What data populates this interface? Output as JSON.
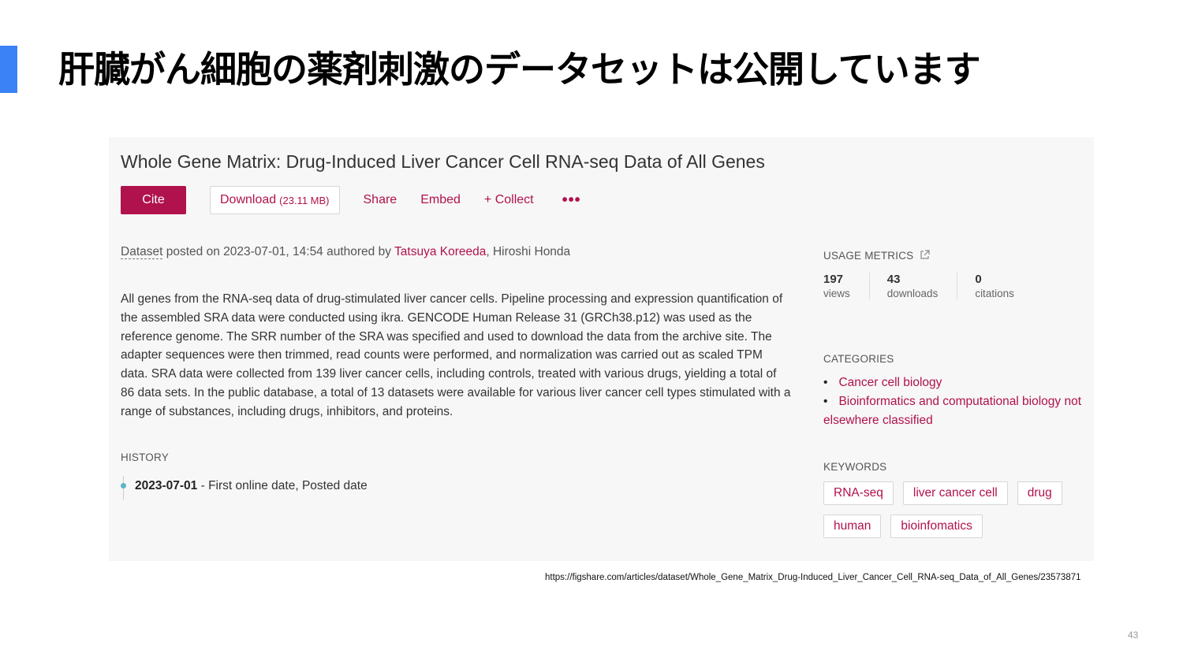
{
  "slide": {
    "title": "肝臓がん細胞の薬剤刺激のデータセットは公開しています",
    "source_url": "https://figshare.com/articles/dataset/Whole_Gene_Matrix_Drug-Induced_Liver_Cancer_Cell_RNA-seq_Data_of_All_Genes/23573871",
    "page_number": "43",
    "accent_color": "#3b82f6"
  },
  "dataset": {
    "title": "Whole Gene Matrix: Drug-Induced Liver Cancer Cell RNA-seq Data of All Genes",
    "toolbar": {
      "cite_label": "Cite",
      "download_label": "Download",
      "download_size": "(23.11 MB)",
      "share_label": "Share",
      "embed_label": "Embed",
      "collect_label": "+ Collect",
      "more_label": "•••"
    },
    "byline": {
      "type": "Dataset",
      "posted_text": " posted on 2023-07-01, 14:54 authored by ",
      "author_1": "Tatsuya Koreeda",
      "author_2": ", Hiroshi Honda"
    },
    "description": "All genes from the RNA-seq data of drug-stimulated liver cancer cells. Pipeline processing and expression quantification of the assembled SRA data were conducted using ikra. GENCODE Human Release 31 (GRCh38.p12) was used as the reference genome. The SRR number of the SRA was specified and used to download the data from the archive site. The adapter sequences were then trimmed, read counts were performed, and normalization was carried out as scaled TPM data.  SRA data were collected from 139 liver cancer cells, including controls, treated with various drugs, yielding a total of 86 data sets. In the public database, a total of 13 datasets were available for various liver cancer cell types stimulated with a range of substances, including drugs, inhibitors, and proteins.",
    "history": {
      "heading": "HISTORY",
      "date": "2023-07-01",
      "text": " - First online date, Posted date"
    },
    "brand_color": "#b0124d"
  },
  "sidebar": {
    "usage_heading": "USAGE METRICS",
    "metrics": [
      {
        "value": "197",
        "label": "views"
      },
      {
        "value": "43",
        "label": "downloads"
      },
      {
        "value": "0",
        "label": "citations"
      }
    ],
    "categories_heading": "CATEGORIES",
    "categories": [
      "Cancer cell biology",
      "Bioinformatics and computational biology not elsewhere classified"
    ],
    "keywords_heading": "KEYWORDS",
    "keywords": [
      "RNA-seq",
      "liver cancer cell",
      "drug",
      "human",
      "bioinfomatics"
    ]
  }
}
